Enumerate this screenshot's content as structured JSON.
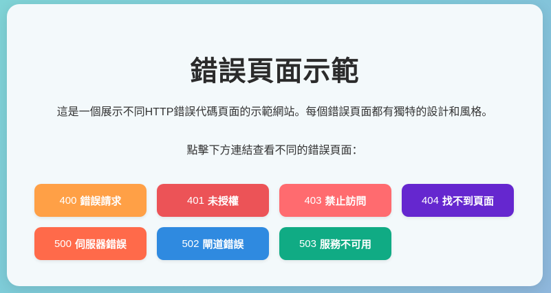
{
  "page": {
    "title": "錯誤頁面示範",
    "description": "這是一個展示不同HTTP錯誤代碼頁面的示範網站。每個錯誤頁面都有獨特的設計和風格。",
    "prompt": "點擊下方連結查看不同的錯誤頁面："
  },
  "buttons": [
    {
      "code": "400",
      "label": "錯誤請求",
      "color": "#ffa046"
    },
    {
      "code": "401",
      "label": "未授權",
      "color": "#ec5357"
    },
    {
      "code": "403",
      "label": "禁止訪問",
      "color": "#ff6b6f"
    },
    {
      "code": "404",
      "label": "找不到頁面",
      "color": "#6527cf"
    },
    {
      "code": "500",
      "label": "伺服器錯誤",
      "color": "#ff6a4a"
    },
    {
      "code": "502",
      "label": "閘道錯誤",
      "color": "#2f8ae0"
    },
    {
      "code": "503",
      "label": "服務不可用",
      "color": "#10ab84"
    }
  ]
}
